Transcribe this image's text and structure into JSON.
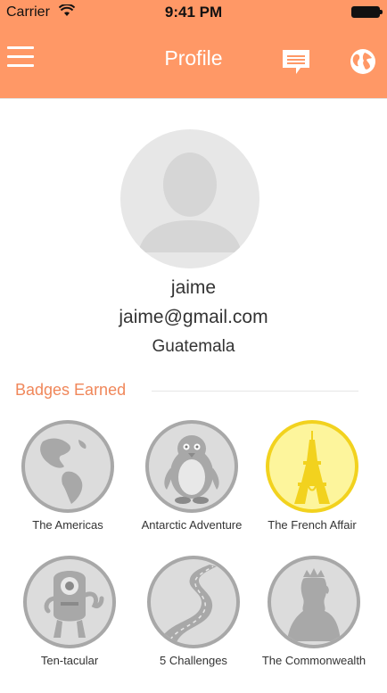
{
  "status_bar": {
    "carrier": "Carrier",
    "time": "9:41 PM"
  },
  "nav": {
    "title": "Profile",
    "menu_icon": "hamburger-menu-icon",
    "chat_icon": "chat-bubble-icon",
    "globe_icon": "globe-icon"
  },
  "profile": {
    "name": "jaime",
    "email": "jaime@gmail.com",
    "country": "Guatemala"
  },
  "badges_section": {
    "title": "Badges Earned"
  },
  "badges": [
    {
      "label": "The Americas",
      "icon": "americas-globe-icon",
      "earned": false
    },
    {
      "label": "Antarctic Adventure",
      "icon": "penguin-icon",
      "earned": false
    },
    {
      "label": "The French Affair",
      "icon": "eiffel-tower-icon",
      "earned": true
    },
    {
      "label": "Ten-tacular",
      "icon": "tentacle-monster-icon",
      "earned": false
    },
    {
      "label": "5 Challenges",
      "icon": "road-icon",
      "earned": false
    },
    {
      "label": "The Commonwealth",
      "icon": "queen-silhouette-icon",
      "earned": false
    }
  ],
  "colors": {
    "header": "#ff9866",
    "accent": "#f0875a",
    "badge_locked": "#a8a8a8",
    "badge_earned": "#f2d21e"
  }
}
